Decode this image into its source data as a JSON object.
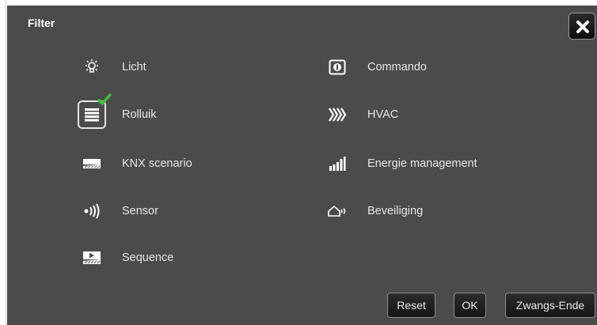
{
  "dialog": {
    "title": "Filter"
  },
  "items": [
    {
      "label": "Licht",
      "icon": "light-bulb-icon",
      "selected": false
    },
    {
      "label": "Rolluik",
      "icon": "rolluik-icon",
      "selected": true
    },
    {
      "label": "KNX scenario",
      "icon": "knx-scenario-icon",
      "selected": false
    },
    {
      "label": "Sensor",
      "icon": "sensor-icon",
      "selected": false
    },
    {
      "label": "Sequence",
      "icon": "sequence-icon",
      "selected": false
    },
    {
      "label": "Commando",
      "icon": "commando-icon",
      "selected": false
    },
    {
      "label": "HVAC",
      "icon": "hvac-icon",
      "selected": false
    },
    {
      "label": "Energie management",
      "icon": "energy-bars-icon",
      "selected": false
    },
    {
      "label": "Beveiliging",
      "icon": "security-icon",
      "selected": false
    }
  ],
  "buttons": {
    "reset": "Reset",
    "ok": "OK",
    "force_end": "Zwangs-Ende"
  },
  "colors": {
    "panel": "#4b4b4b",
    "check": "#3fbf3f",
    "text": "#e6e6e6"
  }
}
